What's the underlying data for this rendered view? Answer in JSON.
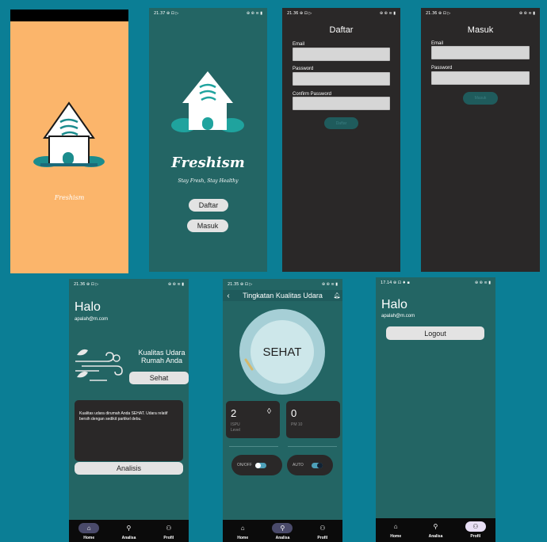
{
  "splash": {
    "brand": "Freshism"
  },
  "welcome": {
    "status_time": "21.37",
    "status_icons": "⊕ ⊡ ▷",
    "status_right": "⊕ ⊛ ≋ ▮",
    "brand": "Freshism",
    "tagline": "Stay Fresh, Stay Healthy",
    "daftar_label": "Daftar",
    "masuk_label": "Masuk"
  },
  "register": {
    "status_time": "21.36",
    "status_icons": "⊕ ⊡ ▷",
    "status_right": "⊕ ⊛ ≋ ▮",
    "title": "Daftar",
    "email_label": "Email",
    "password_label": "Password",
    "confirm_label": "Confirm Password",
    "submit_label": "Daftar"
  },
  "login": {
    "status_time": "21.36",
    "status_icons": "⊕ ⊡ ▷",
    "status_right": "⊕ ⊛ ≋ ▮",
    "title": "Masuk",
    "email_label": "Email",
    "password_label": "Password",
    "submit_label": "Masuk"
  },
  "home": {
    "status_time": "21.36",
    "status_icons": "⊕ ⊡ ▷",
    "status_right": "⊕ ⊛ ≋ ▮",
    "greeting": "Halo",
    "email": "apalah@m.com",
    "card_title_1": "Kualitas Udara",
    "card_title_2": "Rumah Anda",
    "status_button": "Sehat",
    "description": "Kualitas udara dirumah Anda SEHAT. Udara relatif bersih dengan sedikit partikel debu.",
    "analisis_button": "Analisis"
  },
  "analisa": {
    "status_time": "21.35",
    "status_icons": "⊕ ⊡ ▷",
    "status_right": "⊕ ⊛ ≋ ▮",
    "title": "Tingkatan Kualitas Udara",
    "gauge_label": "SEHAT",
    "ispu_value": "2",
    "ispu_label_1": "ISPU",
    "ispu_label_2": "Level",
    "pm_value": "0",
    "pm_label": "PM 10",
    "onoff_label": "ON/OFF",
    "auto_label": "AUTO"
  },
  "profil": {
    "status_time": "17.14",
    "status_icons": "⊕ ⊡ ♦ ▪",
    "status_right": "⊕ ⊛ ≋ ▮",
    "greeting": "Halo",
    "email": "apalah@m.com",
    "logout_label": "Logout"
  },
  "nav": {
    "home": "Home",
    "analisa": "Analisa",
    "profil": "Profil"
  },
  "colors": {
    "background": "#0b7e95",
    "splash": "#fbb56b",
    "teal_screen": "#236564",
    "dark_screen": "#2a2828",
    "button_light": "#e3e3e3",
    "button_teal": "#1f5b5c"
  }
}
